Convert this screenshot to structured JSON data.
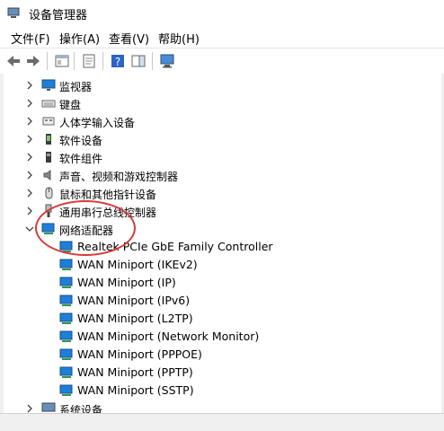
{
  "window": {
    "title": "设备管理器"
  },
  "menu": [
    "文件(F)",
    "操作(A)",
    "查看(V)",
    "帮助(H)"
  ],
  "tree": {
    "categories": [
      {
        "label": "监视器",
        "icon": "monitor-icon",
        "expanded": false
      },
      {
        "label": "键盘",
        "icon": "keyboard-icon",
        "expanded": false
      },
      {
        "label": "人体学输入设备",
        "icon": "hid-icon",
        "expanded": false
      },
      {
        "label": "软件设备",
        "icon": "software-device-icon",
        "expanded": false
      },
      {
        "label": "软件组件",
        "icon": "software-component-icon",
        "expanded": false
      },
      {
        "label": "声音、视频和游戏控制器",
        "icon": "speaker-icon",
        "expanded": false
      },
      {
        "label": "鼠标和其他指针设备",
        "icon": "mouse-icon",
        "expanded": false
      },
      {
        "label": "通用串行总线控制器",
        "icon": "usb-icon",
        "expanded": false
      },
      {
        "label": "网络适配器",
        "icon": "network-adapter-icon",
        "expanded": true
      }
    ],
    "network_children": [
      "Realtek PCIe GbE Family Controller",
      "WAN Miniport (IKEv2)",
      "WAN Miniport (IP)",
      "WAN Miniport (IPv6)",
      "WAN Miniport (L2TP)",
      "WAN Miniport (Network Monitor)",
      "WAN Miniport (PPPOE)",
      "WAN Miniport (PPTP)",
      "WAN Miniport (SSTP)"
    ],
    "partial_next": "系统设备"
  },
  "colors": {
    "highlight_circle": "#d83a3a",
    "icon_blue": "#1e7fd8"
  }
}
